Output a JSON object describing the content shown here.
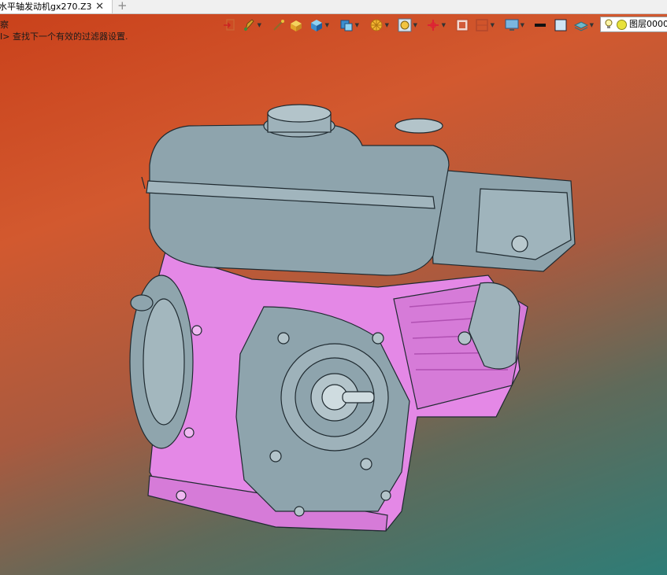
{
  "tab": {
    "title": "水平轴发动机gx270.Z3",
    "close_icon": "close-icon",
    "new_tab_icon": "plus-icon"
  },
  "hints": {
    "line1": "察",
    "line2": "I> 查找下一个有效的过滤器设置."
  },
  "toolbar": {
    "icons": [
      "exit-icon",
      "pen-color-icon",
      "wand-icon",
      "shaded-box-icon",
      "cube-icon",
      "view-cube-icon",
      "render-mode-icon",
      "snap-icon",
      "axis-icon",
      "window-icon",
      "frame-icon",
      "monitor-icon",
      "line-color-icon",
      "fill-color-icon",
      "layers-icon"
    ]
  },
  "layer": {
    "label": "图层0000",
    "bulb_icon": "lightbulb-icon"
  },
  "colors": {
    "casting": "#e488e6",
    "tank": "#8ea4ad",
    "bg_top": "#c9401a",
    "bg_bottom": "#2e7d77"
  }
}
